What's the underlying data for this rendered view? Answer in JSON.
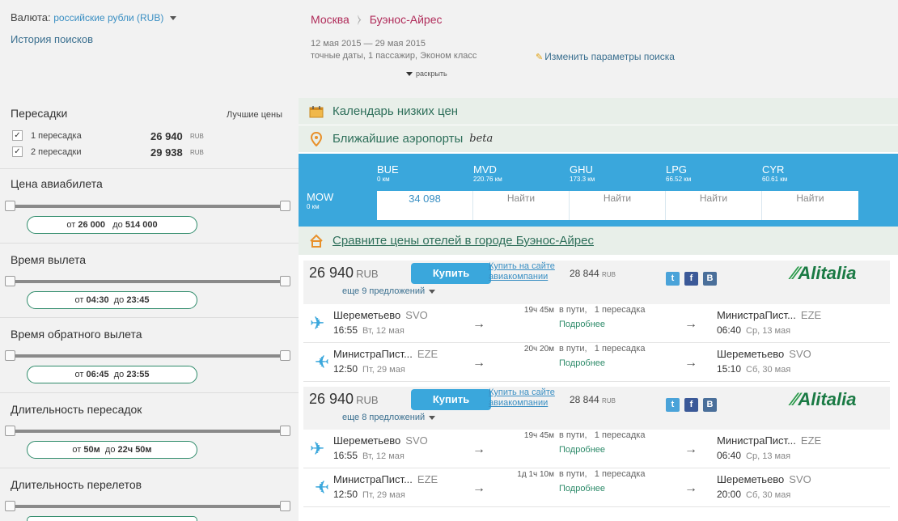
{
  "header": {
    "currency_label": "Валюта:",
    "currency_value": "российские рубли (RUB)",
    "history_link": "История поисков",
    "origin": "Москва",
    "destination": "Буэнос-Айрес",
    "dates": "12 мая 2015  — 29 мая 2015",
    "search_details": "точные даты,  1 пассажир,  Эконом класс",
    "change_params": "Изменить параметры поиска",
    "expand": "раскрыть"
  },
  "filters": {
    "stops_title": "Пересадки",
    "best_prices": "Лучшие цены",
    "stops": [
      {
        "label": "1 пересадка",
        "price": "26 940",
        "currency": "RUB",
        "checked": true
      },
      {
        "label": "2 пересадки",
        "price": "29 938",
        "currency": "RUB",
        "checked": true
      }
    ],
    "ranges": [
      {
        "title": "Цена авиабилета",
        "from_prefix": "от",
        "from": "26 000",
        "to_prefix": "до",
        "to": "514 000"
      },
      {
        "title": "Время вылета",
        "from_prefix": "от",
        "from": "04:30",
        "to_prefix": "до",
        "to": "23:45"
      },
      {
        "title": "Время обратного вылета",
        "from_prefix": "от",
        "from": "06:45",
        "to_prefix": "до",
        "to": "23:55"
      },
      {
        "title": "Длительность пересадок",
        "from_prefix": "от",
        "from": "50м",
        "to_prefix": "до",
        "to": "22ч 50м"
      },
      {
        "title": "Длительность перелетов",
        "from_prefix": "",
        "from": "",
        "to_prefix": "",
        "to": ""
      }
    ]
  },
  "sections": {
    "calendar": "Календарь низких цен",
    "nearby": "Ближайшие аэропорты",
    "beta": "beta",
    "hotels": "Сравните цены отелей в городе Буэнос-Айрес"
  },
  "airports": {
    "origin": {
      "code": "MOW",
      "dist": "0 км"
    },
    "dests": [
      {
        "code": "BUE",
        "dist": "0 км",
        "value": "34 098"
      },
      {
        "code": "MVD",
        "dist": "220.76 км",
        "value": "Найти"
      },
      {
        "code": "GHU",
        "dist": "173.3 км",
        "value": "Найти"
      },
      {
        "code": "LPG",
        "dist": "66.52 км",
        "value": "Найти"
      },
      {
        "code": "CYR",
        "dist": "60.61 км",
        "value": "Найти"
      }
    ]
  },
  "results": [
    {
      "price": "26 940",
      "currency": "RUB",
      "buy": "Купить",
      "airline_site_1": "Купить на сайте",
      "airline_site_2": "авиакомпании",
      "alt_price": "28 844",
      "alt_currency": "RUB",
      "offers": "еще 9 предложений",
      "airline": "Alitalia",
      "legs": [
        {
          "from": "Шереметьево",
          "from_code": "SVO",
          "dep_time": "16:55",
          "dep_date": "Вт, 12 мая",
          "duration": "19ч 45м",
          "in_way": "в пути,",
          "stops": "1 пересадка",
          "details": "Подробнее",
          "to": "МинистраПист...",
          "to_code": "EZE",
          "arr_time": "06:40",
          "arr_date": "Ср, 13 мая"
        },
        {
          "from": "МинистраПист...",
          "from_code": "EZE",
          "dep_time": "12:50",
          "dep_date": "Пт, 29 мая",
          "duration": "20ч 20м",
          "in_way": "в пути,",
          "stops": "1 пересадка",
          "details": "Подробнее",
          "to": "Шереметьево",
          "to_code": "SVO",
          "arr_time": "15:10",
          "arr_date": "Сб, 30 мая"
        }
      ]
    },
    {
      "price": "26 940",
      "currency": "RUB",
      "buy": "Купить",
      "airline_site_1": "Купить на сайте",
      "airline_site_2": "авиакомпании",
      "alt_price": "28 844",
      "alt_currency": "RUB",
      "offers": "еще 8 предложений",
      "airline": "Alitalia",
      "legs": [
        {
          "from": "Шереметьево",
          "from_code": "SVO",
          "dep_time": "16:55",
          "dep_date": "Вт, 12 мая",
          "duration": "19ч 45м",
          "in_way": "в пути,",
          "stops": "1 пересадка",
          "details": "Подробнее",
          "to": "МинистраПист...",
          "to_code": "EZE",
          "arr_time": "06:40",
          "arr_date": "Ср, 13 мая"
        },
        {
          "from": "МинистраПист...",
          "from_code": "EZE",
          "dep_time": "12:50",
          "dep_date": "Пт, 29 мая",
          "duration": "1д 1ч 10м",
          "in_way": "в пути,",
          "stops": "1 пересадка",
          "details": "Подробнее",
          "to": "Шереметьево",
          "to_code": "SVO",
          "arr_time": "20:00",
          "arr_date": "Сб, 30 мая"
        }
      ]
    }
  ],
  "colors": {
    "accent": "#3aa7dc",
    "route": "#b02c5a",
    "link_green": "#2e8b6a",
    "logo": "#1a7a44"
  }
}
